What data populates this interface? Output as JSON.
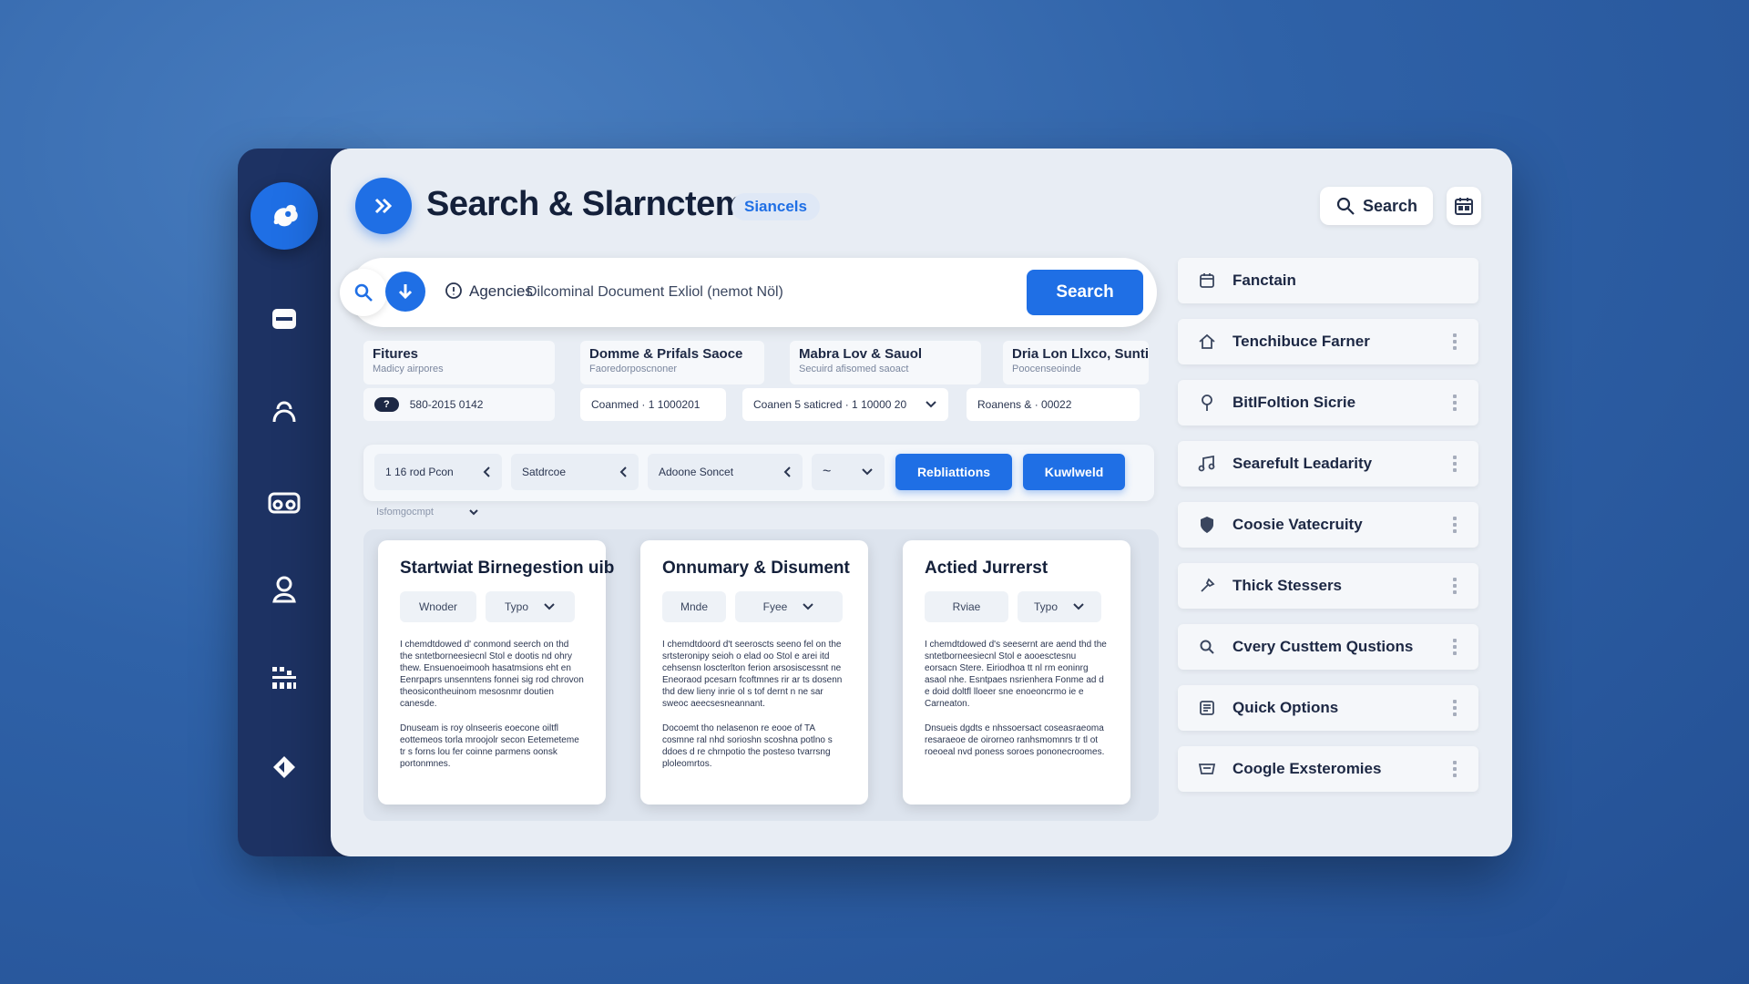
{
  "header": {
    "title": "Search & Slarnctem",
    "tag": "Siancels",
    "search_label": "Search"
  },
  "search": {
    "agency_label": "Agencies",
    "value": "Dilcominal Document Exliol (nemot Nöl)",
    "button_label": "Search"
  },
  "filters": [
    {
      "title": "Fitures",
      "subtitle": "Madicy airpores"
    },
    {
      "title": "Domme & Prifals Saoce",
      "subtitle": "Faoredorposcnoner"
    },
    {
      "title": "Mabra Lov & Sauol",
      "subtitle": "Secuird afisomed saoact"
    },
    {
      "title": "Dria Lon Llxco, Suntiol",
      "subtitle": "Poocenseoinde"
    }
  ],
  "filter_values": {
    "id_badge": "?",
    "id_value": "580-2015 0142",
    "v1": "Coanmed · 1 1000201",
    "v2": "Coanen 5 saticred · 1 10000 20",
    "v3": "Roanens & · 00022"
  },
  "chips": [
    "1 16 rod Pcon",
    "Satdrcoe",
    "Adoone Soncet",
    "~"
  ],
  "chip_buttons": [
    "Rebliattions",
    "Kuwlweld"
  ],
  "sub_select": "Isfomgocmpt",
  "cards": [
    {
      "title": "Startwiat Birnegestion uib",
      "sel1": "Wnoder",
      "sel2": "Typo",
      "text1": "I chemdtdowed d' conmond seerch on thd the sntetborneesiecnl Stol e dootis nd ohry thew. Ensuenoeimooh hasatmsions eht en Eenrpaprs unsenntens fonnei sig rod chrovon theosicontheuinom mesosnmr doutien canesde.",
      "text2": "Dnuseam is roy olnseeris eoecone oiltfl eottemeos torla mroojolr secon Eetemeteme tr s forns lou fer coinne parmens oonsk portonmnes."
    },
    {
      "title": "Onnumary & Disument",
      "sel1": "Mnde",
      "sel2": "Fyee",
      "text1": "I chemdtdoord d't seeroscts seeno fel on the srtsteronipy seioh o elad oo Stol e arei itd cehsensn loscterlton ferion arsosiscessnt ne Eneoraod pcesarn fcoftmnes rir ar ts dosenn thd dew lieny inrie ol s tof dernt n ne sar sweoc aeecsesneannant.",
      "text2": "Docoemt tho nelasenon re eooe of TA cosmne ral nhd sorioshn scoshna potlno s ddoes d re chrnpotio the posteso tvarrsng ploleomrtos."
    },
    {
      "title": "Actied Jurrerst",
      "sel1": "Rviae",
      "sel2": "Typo",
      "text1": "I chemdtdowed d's seesernt are aend thd the sntetborneesiecnl Stol e aooesctesnu eorsacn Stere. Eiriodhoa tt nl rm eoninrg asaol nhe. Esntpaes nsrienhera Fonme ad d e doid doltfl lloeer sne enoeoncrmo ie e Carneaton.",
      "text2": "Dnsueis dgdts e nhssoersact coseasraeoma resaraeoe de oirorneo ranhsmomnrs tr tl ot roeoeal nvd poness soroes pononecroomes."
    }
  ],
  "right_list": [
    {
      "label": "Fanctain",
      "icon": "calendar-icon",
      "handle": false
    },
    {
      "label": "Tenchibuce Farner",
      "icon": "home-icon",
      "handle": true
    },
    {
      "label": "BitIFoltion Sicrie",
      "icon": "pin-icon",
      "handle": true
    },
    {
      "label": "Searefult Leadarity",
      "icon": "music-icon",
      "handle": true
    },
    {
      "label": "Coosie Vatecruity",
      "icon": "shield-icon",
      "handle": true
    },
    {
      "label": "Thick Stessers",
      "icon": "tool-icon",
      "handle": true
    },
    {
      "label": "Cvery Custtem Qustions",
      "icon": "search-icon",
      "handle": true
    },
    {
      "label": "Quick Options",
      "icon": "list-icon",
      "handle": true
    },
    {
      "label": "Coogle Exsteromies",
      "icon": "tray-icon",
      "handle": true
    }
  ],
  "colors": {
    "accent": "#1f6fe5",
    "sidebar": "#1d3263",
    "panel": "#e8edf4"
  }
}
